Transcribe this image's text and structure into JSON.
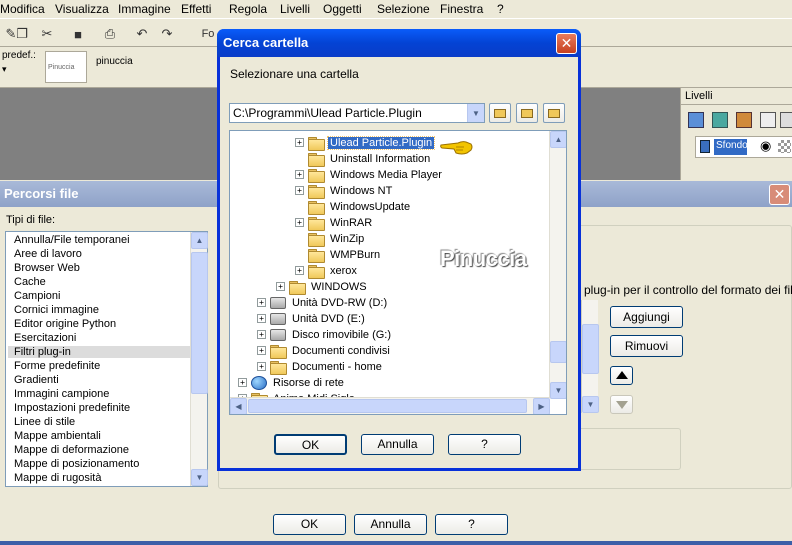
{
  "menu": [
    "Modifica",
    "Visualizza",
    "Immagine",
    "Effetti",
    "Regola",
    "Livelli",
    "Oggetti",
    "Selezione",
    "Finestra",
    "?"
  ],
  "toolbar": {
    "font_label": "Fo"
  },
  "propbar": {
    "preset_label": "predef.:",
    "preset_thumb": "Pinuccia",
    "preset_name": "pinuccia"
  },
  "layers_panel": {
    "title": "Livelli",
    "layer_name": "Sfondo"
  },
  "percorsi_file": {
    "title": "Percorsi file",
    "types_label": "Tipi di file:",
    "file_types": [
      "Annulla/File temporanei",
      "Aree di lavoro",
      "Browser Web",
      "Cache",
      "Campioni",
      "Cornici immagine",
      "Editor origine Python",
      "Esercitazioni",
      "Filtri plug-in",
      "Forme predefinite",
      "Gradienti",
      "Immagini campione",
      "Impostazioni predefinite",
      "Linee di stile",
      "Mappe ambientali",
      "Mappe di deformazione",
      "Mappe di posizionamento",
      "Mappe di rugosità"
    ],
    "selected_type": "Filtri plug-in",
    "info_text": "plug-in per il controllo del formato dei file",
    "add_label": "Aggiungi",
    "remove_label": "Rimuovi",
    "ok_label": "OK",
    "cancel_label": "Annulla",
    "help_label": "?"
  },
  "cerca_cartella": {
    "title": "Cerca cartella",
    "prompt": "Selezionare una cartella",
    "path": "C:\\Programmi\\Ulead Particle.Plugin",
    "tree": [
      {
        "label": "Ulead Particle.Plugin",
        "indent": 3,
        "expander": "+",
        "icon": "folder",
        "selected": true
      },
      {
        "label": "Uninstall Information",
        "indent": 3,
        "expander": "",
        "icon": "folder"
      },
      {
        "label": "Windows Media Player",
        "indent": 3,
        "expander": "+",
        "icon": "folder"
      },
      {
        "label": "Windows NT",
        "indent": 3,
        "expander": "+",
        "icon": "folder"
      },
      {
        "label": "WindowsUpdate",
        "indent": 3,
        "expander": "",
        "icon": "folder"
      },
      {
        "label": "WinRAR",
        "indent": 3,
        "expander": "+",
        "icon": "folder"
      },
      {
        "label": "WinZip",
        "indent": 3,
        "expander": "",
        "icon": "folder"
      },
      {
        "label": "WMPBurn",
        "indent": 3,
        "expander": "",
        "icon": "folder"
      },
      {
        "label": "xerox",
        "indent": 3,
        "expander": "+",
        "icon": "folder"
      },
      {
        "label": "WINDOWS",
        "indent": 2,
        "expander": "+",
        "icon": "folder"
      },
      {
        "label": "Unità DVD-RW (D:)",
        "indent": 1,
        "expander": "+",
        "icon": "drive"
      },
      {
        "label": "Unità DVD (E:)",
        "indent": 1,
        "expander": "+",
        "icon": "drive"
      },
      {
        "label": "Disco rimovibile (G:)",
        "indent": 1,
        "expander": "+",
        "icon": "drive"
      },
      {
        "label": "Documenti condivisi",
        "indent": 1,
        "expander": "+",
        "icon": "folder"
      },
      {
        "label": "Documenti - home",
        "indent": 1,
        "expander": "+",
        "icon": "folder"
      },
      {
        "label": "Risorse di rete",
        "indent": 0,
        "expander": "+",
        "icon": "net"
      },
      {
        "label": "Anime Midi Sigle",
        "indent": 0,
        "expander": "+",
        "icon": "folder"
      }
    ],
    "watermark": "Pinuccia",
    "ok_label": "OK",
    "cancel_label": "Annulla",
    "help_label": "?"
  },
  "colors": {
    "titlebar_blue": "#0a5cfa",
    "selection_blue": "#316ac5",
    "dialog_bg": "#ece9d8"
  }
}
